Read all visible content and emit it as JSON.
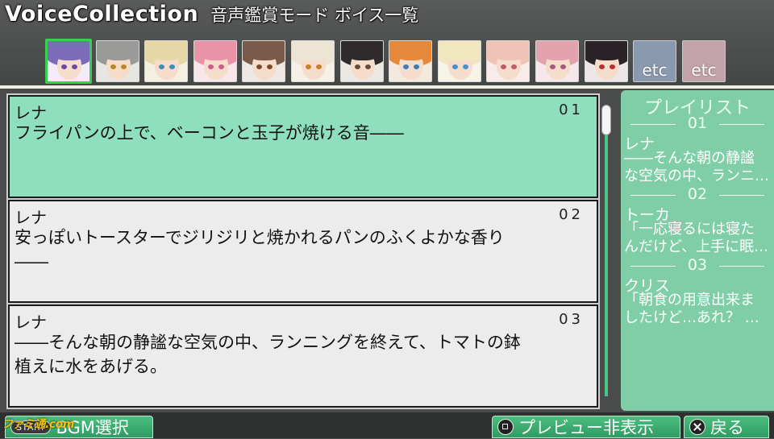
{
  "header": {
    "title": "VoiceCollection",
    "subtitle": "音声鑑賞モード ボイス一覧"
  },
  "characters": [
    {
      "icon": "character-portrait-1",
      "hair": "#7b6bb8",
      "eye": "#6a4aa0",
      "bg": "#f1ecf7",
      "selected": true
    },
    {
      "icon": "character-portrait-2",
      "hair": "#9a9a98",
      "eye": "#b58a2a",
      "bg": "#e7e6e2"
    },
    {
      "icon": "character-portrait-3",
      "hair": "#e6d7a6",
      "eye": "#3b8fb6",
      "bg": "#f3efe3"
    },
    {
      "icon": "character-portrait-4",
      "hair": "#e993a9",
      "eye": "#d0588a",
      "bg": "#f8e6ea"
    },
    {
      "icon": "character-portrait-5",
      "hair": "#7a5a48",
      "eye": "#7a4b2d",
      "bg": "#efe8e2"
    },
    {
      "icon": "character-portrait-6",
      "hair": "#ece5d3",
      "eye": "#c9802a",
      "bg": "#f5f1e7"
    },
    {
      "icon": "character-portrait-7",
      "hair": "#2f2b2d",
      "eye": "#6a4b3a",
      "bg": "#ebe7e3"
    },
    {
      "icon": "character-portrait-8",
      "hair": "#e58a3a",
      "eye": "#3b7db8",
      "bg": "#f4e9dd"
    },
    {
      "icon": "character-portrait-9",
      "hair": "#f0e7bf",
      "eye": "#4a8fcc",
      "bg": "#f6f3e7"
    },
    {
      "icon": "character-portrait-10",
      "hair": "#f0c3b7",
      "eye": "#c05a6a",
      "bg": "#f8ece8"
    },
    {
      "icon": "character-portrait-11",
      "hair": "#e2a3ae",
      "eye": "#a45a7a",
      "bg": "#f5e7ea"
    },
    {
      "icon": "character-portrait-12",
      "hair": "#2a2428",
      "eye": "#b8302e",
      "bg": "#ece7e6"
    }
  ],
  "etc_tabs": [
    {
      "label": "etc",
      "color": "#8a9aae"
    },
    {
      "label": "etc",
      "color": "#c2a3aa"
    }
  ],
  "voices": [
    {
      "speaker": "レナ",
      "number": "01",
      "line1": "フライパンの上で、ベーコンと玉子が焼ける音――",
      "line2": "",
      "selected": true
    },
    {
      "speaker": "レナ",
      "number": "02",
      "line1": "安っぽいトースターでジリジリと焼かれるパンのふくよかな香り",
      "line2": "――"
    },
    {
      "speaker": "レナ",
      "number": "03",
      "line1": "――そんな朝の静謐な空気の中、ランニングを終えて、トマトの鉢",
      "line2": "植えに水をあげる。"
    }
  ],
  "playlist": {
    "title": "プレイリスト",
    "items": [
      {
        "number": "01",
        "speaker": "レナ",
        "text1": "――そんな朝の静謐",
        "text2": "な空気の中、ランニ…"
      },
      {
        "number": "02",
        "speaker": "トーカ",
        "text1": "「一応寝るには寝た",
        "text2": "んだけど、上手に眠…"
      },
      {
        "number": "03",
        "speaker": "クリス",
        "text1": "「朝食の用意出来ま",
        "text2": "したけど…あれ？ …"
      }
    ]
  },
  "footer": {
    "start_key": "START",
    "bgm_label": "BGM選択",
    "preview_label": "プレビュー非表示",
    "back_label": "戻る",
    "watermark": "ファミ通.com"
  },
  "colors": {
    "accent_green": "#4dbd7f",
    "selected_row": "#8edfbd",
    "playlist_bg": "#7fcea8",
    "selected_border": "#35d04c"
  }
}
